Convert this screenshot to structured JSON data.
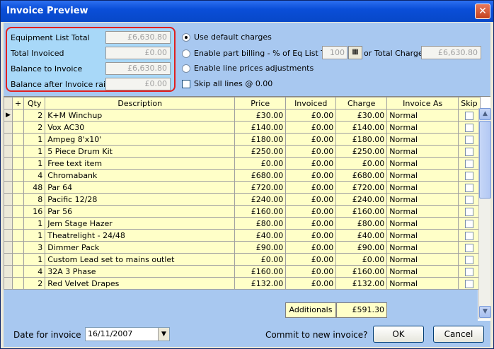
{
  "window": {
    "title": "Invoice Preview",
    "close": "✕"
  },
  "summary": [
    {
      "label": "Equipment List Total",
      "value": "£6,630.80"
    },
    {
      "label": "Total Invoiced",
      "value": "£0.00"
    },
    {
      "label": "Balance to Invoice",
      "value": "£6,630.80"
    },
    {
      "label": "Balance after Invoice raised",
      "value": "£0.00"
    }
  ],
  "options": {
    "default_charges": "Use default charges",
    "part_billing": "Enable part billing - % of Eq List Total",
    "percent": "100",
    "or": "or",
    "total_charge_label": "Total Charge",
    "total_charge": "£6,630.80",
    "line_prices": "Enable line prices adjustments",
    "skip_all": "Skip all lines @ 0.00"
  },
  "grid": {
    "headers": {
      "plus": "+",
      "qty": "Qty",
      "desc": "Description",
      "price": "Price",
      "invoiced": "Invoiced",
      "charge": "Charge",
      "invoice_as": "Invoice As",
      "skip": "Skip"
    },
    "rows": [
      {
        "qty": "2",
        "desc": "K+M Winchup",
        "price": "£30.00",
        "invoiced": "£0.00",
        "charge": "£30.00",
        "as": "Normal"
      },
      {
        "qty": "2",
        "desc": "Vox AC30",
        "price": "£140.00",
        "invoiced": "£0.00",
        "charge": "£140.00",
        "as": "Normal"
      },
      {
        "qty": "1",
        "desc": "Ampeg 8'x10'",
        "price": "£180.00",
        "invoiced": "£0.00",
        "charge": "£180.00",
        "as": "Normal"
      },
      {
        "qty": "1",
        "desc": "5 Piece Drum Kit",
        "price": "£250.00",
        "invoiced": "£0.00",
        "charge": "£250.00",
        "as": "Normal"
      },
      {
        "qty": "1",
        "desc": "Free text item",
        "price": "£0.00",
        "invoiced": "£0.00",
        "charge": "£0.00",
        "as": "Normal"
      },
      {
        "qty": "4",
        "desc": "Chromabank",
        "price": "£680.00",
        "invoiced": "£0.00",
        "charge": "£680.00",
        "as": "Normal"
      },
      {
        "qty": "48",
        "desc": "Par 64",
        "price": "£720.00",
        "invoiced": "£0.00",
        "charge": "£720.00",
        "as": "Normal"
      },
      {
        "qty": "8",
        "desc": "Pacific 12/28",
        "price": "£240.00",
        "invoiced": "£0.00",
        "charge": "£240.00",
        "as": "Normal"
      },
      {
        "qty": "16",
        "desc": "Par 56",
        "price": "£160.00",
        "invoiced": "£0.00",
        "charge": "£160.00",
        "as": "Normal"
      },
      {
        "qty": "1",
        "desc": "Jem Stage Hazer",
        "price": "£80.00",
        "invoiced": "£0.00",
        "charge": "£80.00",
        "as": "Normal"
      },
      {
        "qty": "1",
        "desc": "Theatrelight - 24/48",
        "price": "£40.00",
        "invoiced": "£0.00",
        "charge": "£40.00",
        "as": "Normal"
      },
      {
        "qty": "3",
        "desc": "Dimmer Pack",
        "price": "£90.00",
        "invoiced": "£0.00",
        "charge": "£90.00",
        "as": "Normal"
      },
      {
        "qty": "1",
        "desc": "Custom Lead set to mains outlet",
        "price": "£0.00",
        "invoiced": "£0.00",
        "charge": "£0.00",
        "as": "Normal"
      },
      {
        "qty": "4",
        "desc": "32A 3 Phase",
        "price": "£160.00",
        "invoiced": "£0.00",
        "charge": "£160.00",
        "as": "Normal"
      },
      {
        "qty": "2",
        "desc": "Red Velvet Drapes",
        "price": "£132.00",
        "invoiced": "£0.00",
        "charge": "£132.00",
        "as": "Normal"
      }
    ]
  },
  "additionals": {
    "label": "Additionals",
    "value": "£591.30"
  },
  "footer": {
    "date_label": "Date for invoice",
    "date": "16/11/2007",
    "commit": "Commit to new invoice?",
    "ok": "OK",
    "cancel": "Cancel"
  }
}
